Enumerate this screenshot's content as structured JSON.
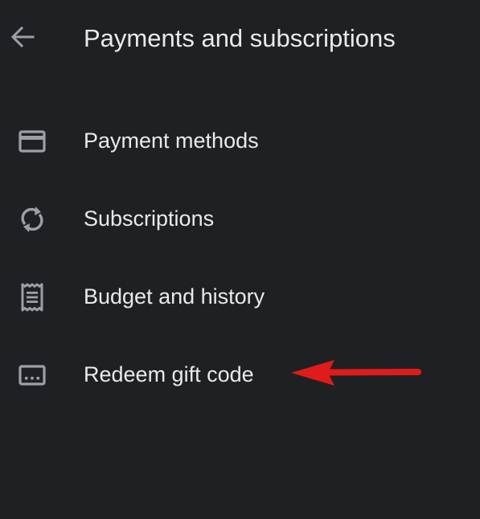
{
  "header": {
    "back_icon": "arrow-back-icon",
    "title": "Payments and subscriptions"
  },
  "menu": {
    "items": [
      {
        "label": "Payment methods",
        "icon": "credit-card-icon"
      },
      {
        "label": "Subscriptions",
        "icon": "sync-icon"
      },
      {
        "label": "Budget and history",
        "icon": "receipt-icon"
      },
      {
        "label": "Redeem gift code",
        "icon": "redeem-code-icon"
      }
    ]
  },
  "annotation": {
    "arrow_color": "#e01b1b",
    "points_to": "Redeem gift code"
  },
  "colors": {
    "background": "#1f2023",
    "text": "#e8eaed",
    "icon": "#9aa0a6"
  }
}
